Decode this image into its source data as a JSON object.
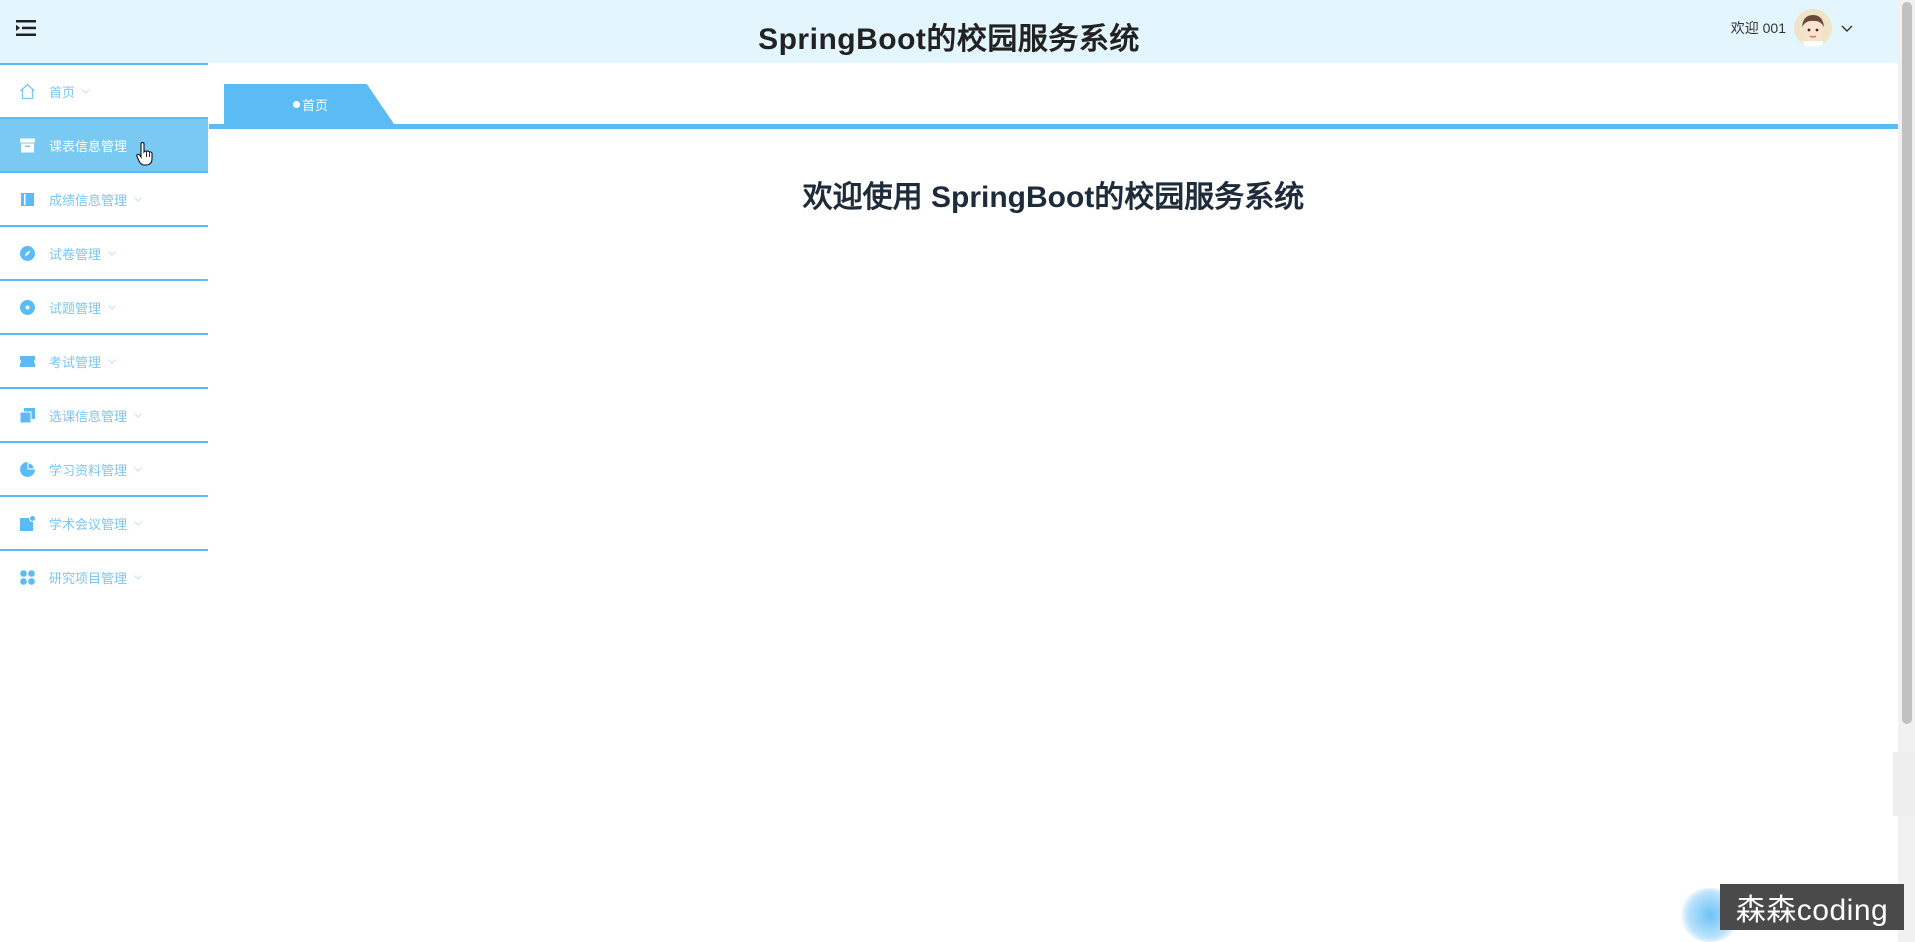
{
  "header": {
    "title": "SpringBoot的校园服务系统",
    "welcome": "欢迎 001",
    "menu_icon": "hamburger-icon",
    "avatar_icon": "avatar-icon",
    "chevron_icon": "chevron-down-icon"
  },
  "sidebar": {
    "active_index": 1,
    "items": [
      {
        "label": "首页",
        "icon": "home-icon"
      },
      {
        "label": "课表信息管理",
        "icon": "archive-icon"
      },
      {
        "label": "成绩信息管理",
        "icon": "book-icon"
      },
      {
        "label": "试卷管理",
        "icon": "compass-icon"
      },
      {
        "label": "试题管理",
        "icon": "disc-icon"
      },
      {
        "label": "考试管理",
        "icon": "ticket-icon"
      },
      {
        "label": "选课信息管理",
        "icon": "copy-icon"
      },
      {
        "label": "学习资料管理",
        "icon": "pie-chart-icon"
      },
      {
        "label": "学术会议管理",
        "icon": "notification-icon"
      },
      {
        "label": "研究项目管理",
        "icon": "grid-icon"
      }
    ]
  },
  "tabs": [
    {
      "label": "首页",
      "active": true
    }
  ],
  "main": {
    "welcome_heading": "欢迎使用 SpringBoot的校园服务系统"
  },
  "watermark": {
    "text": "森森coding"
  },
  "colors": {
    "header_bg": "#e4f6fd",
    "accent": "#5bbcf5",
    "active_item": "#79c9f3",
    "menu_text": "#7dc6f1",
    "heading": "#1d2b3a"
  }
}
